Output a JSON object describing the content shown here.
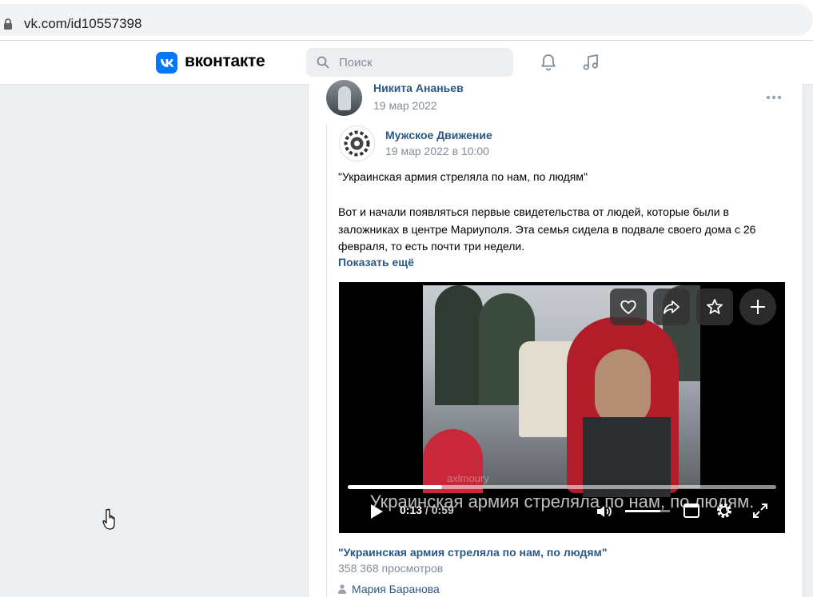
{
  "browser": {
    "url": "vk.com/id10557398"
  },
  "header": {
    "brand": "вконтакте",
    "search": {
      "placeholder": "Поиск"
    },
    "icons": [
      "bell-icon",
      "music-icon"
    ],
    "accent_color": "#0077ff"
  },
  "post": {
    "author": "Никита Ананьев",
    "date": "19 мар 2022",
    "repost": {
      "group": "Мужское Движение",
      "date": "19 мар 2022 в 10:00",
      "quote": "\"Украинская армия стреляла по нам, по людям\"",
      "body": "Вот и начали появляться первые свидетельства от людей, которые были в заложниках в центре Мариуполя. Эта семья сидела в подвале своего дома с 26 февраля, то есть почти три недели.",
      "show_more": "Показать ещё"
    },
    "video": {
      "subtitle": "Украинская армия стреляла по нам, по людям.",
      "current_time": "0:13",
      "total_time": "0:59",
      "progress": 0.22,
      "volume": 0.78,
      "watermark": "axlmoury",
      "title": "\"Украинская армия стреляла по нам, по людям\"",
      "views": "358 368 просмотров",
      "uploader": "Мария Баранова"
    }
  }
}
